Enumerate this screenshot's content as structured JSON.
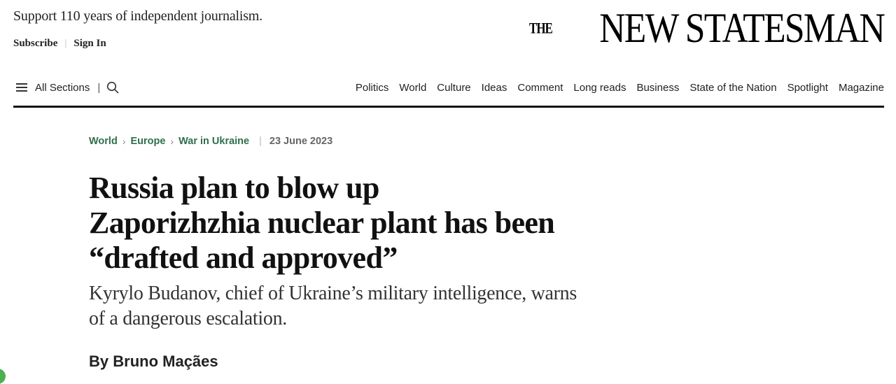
{
  "header": {
    "support_text": "Support 110 years of independent journalism.",
    "subscribe_label": "Subscribe",
    "sign_in_label": "Sign In",
    "logo": {
      "the": "THE",
      "name": "NEW STATESMAN"
    }
  },
  "nav": {
    "all_sections_label": "All Sections",
    "separator": "|",
    "links": [
      "Politics",
      "World",
      "Culture",
      "Ideas",
      "Comment",
      "Long reads",
      "Business",
      "State of the Nation",
      "Spotlight",
      "Magazine"
    ]
  },
  "article": {
    "breadcrumb": [
      "World",
      "Europe",
      "War in Ukraine"
    ],
    "date": "23 June 2023",
    "headline_lines": [
      "Russia plan to blow up",
      "Zaporizhzhia nuclear plant has been",
      "“drafted and approved”"
    ],
    "standfirst_lines": [
      "Kyrylo Budanov, chief of Ukraine’s military intelligence, warns",
      "of a dangerous escalation."
    ],
    "byline_prefix": "By",
    "author": "Bruno Maçães"
  },
  "colors": {
    "accent_green": "#2f6f4c",
    "rule": "#111111"
  }
}
